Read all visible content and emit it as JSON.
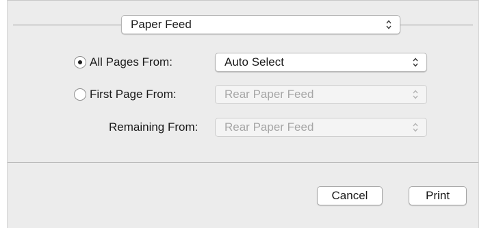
{
  "header": {
    "panel_select": {
      "value": "Paper Feed",
      "icon": "updown-arrows-icon"
    }
  },
  "feed_options": {
    "all_pages": {
      "label": "All Pages From:",
      "selected": true,
      "source": "Auto Select",
      "enabled": true
    },
    "first_page": {
      "label": "First Page From:",
      "selected": false,
      "source": "Rear Paper Feed",
      "enabled": false
    },
    "remaining": {
      "label": "Remaining From:",
      "source": "Rear Paper Feed",
      "enabled": false
    }
  },
  "footer": {
    "cancel_label": "Cancel",
    "print_label": "Print"
  },
  "colors": {
    "dialog_background": "#ececec",
    "disabled_text": "#a6a6a6"
  }
}
